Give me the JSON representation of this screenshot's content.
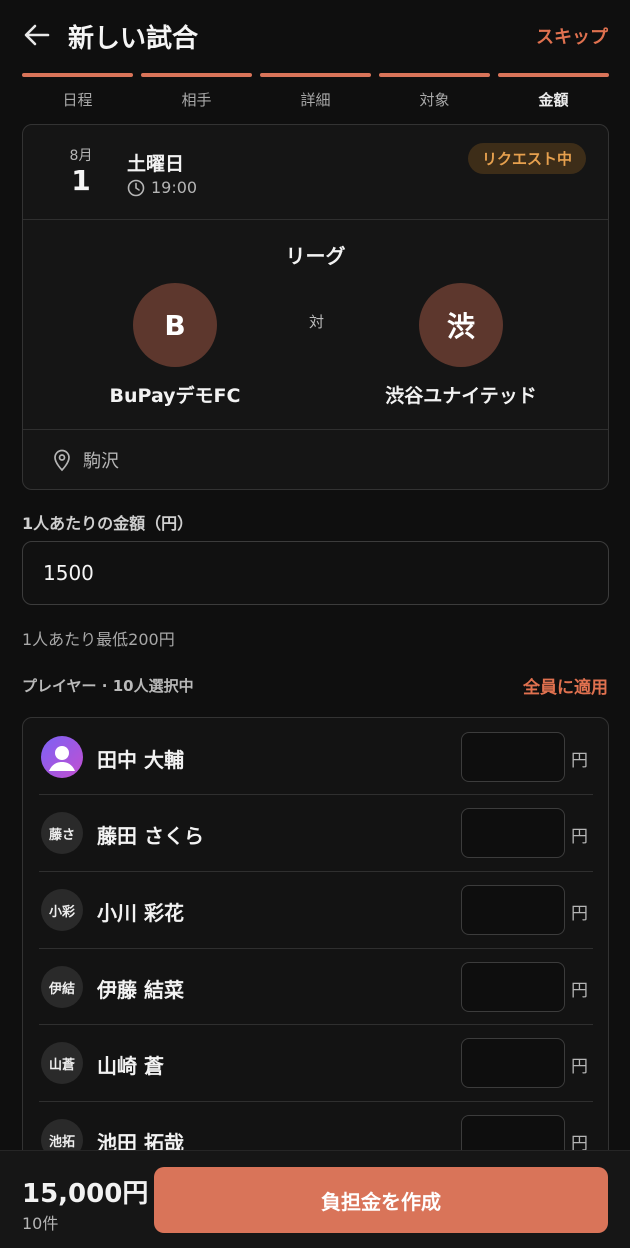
{
  "header": {
    "title": "新しい試合",
    "skip_label": "スキップ"
  },
  "steps": [
    {
      "label": "日程"
    },
    {
      "label": "相手"
    },
    {
      "label": "詳細"
    },
    {
      "label": "対象"
    },
    {
      "label": "金額"
    }
  ],
  "match": {
    "month": "8月",
    "day": "1",
    "weekday": "土曜日",
    "time": "19:00",
    "status_badge": "リクエスト中",
    "league": "リーグ",
    "versus": "対",
    "home": {
      "crest": "B",
      "name": "BuPayデモFC"
    },
    "away": {
      "crest": "渋",
      "name": "渋谷ユナイテッド"
    },
    "venue": "駒沢"
  },
  "amount": {
    "label": "1人あたりの金額（円）",
    "value": "1500",
    "min_note": "1人あたり最低200円"
  },
  "players_section": {
    "heading": "プレイヤー · 10人選択中",
    "apply_all_label": "全員に適用",
    "unit": "円",
    "players": [
      {
        "initials": "",
        "name": "田中 大輔"
      },
      {
        "initials": "藤さ",
        "name": "藤田 さくら"
      },
      {
        "initials": "小彩",
        "name": "小川 彩花"
      },
      {
        "initials": "伊結",
        "name": "伊藤 結菜"
      },
      {
        "initials": "山蒼",
        "name": "山崎 蒼"
      },
      {
        "initials": "池拓",
        "name": "池田 拓哉"
      }
    ]
  },
  "footer": {
    "total": "15,000円",
    "count": "10件",
    "create_label": "負担金を作成"
  },
  "colors": {
    "accent": "#d97459",
    "badge_text": "#e6a04e",
    "crest_bg": "#5d372d"
  }
}
